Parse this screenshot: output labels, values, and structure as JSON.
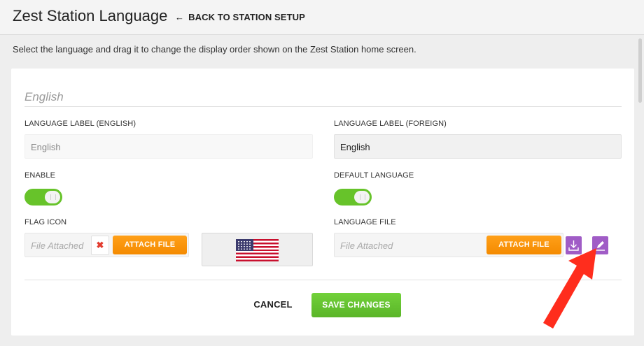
{
  "header": {
    "title": "Zest Station Language",
    "back_label": "BACK TO STATION SETUP"
  },
  "instructions": "Select the language and drag it to change the display order shown on the Zest Station home screen.",
  "language": {
    "name": "English",
    "label_english": {
      "label": "LANGUAGE LABEL (ENGLISH)",
      "value": "English"
    },
    "label_foreign": {
      "label": "LANGUAGE LABEL (FOREIGN)",
      "value": "English"
    },
    "enable": {
      "label": "ENABLE",
      "on": true
    },
    "default_language": {
      "label": "DEFAULT LANGUAGE",
      "on": true
    },
    "flag_icon": {
      "label": "FLAG ICON",
      "placeholder": "File Attached",
      "remove_glyph": "✖",
      "attach_label": "ATTACH FILE",
      "preview_icon": "us-flag"
    },
    "language_file": {
      "label": "LANGUAGE FILE",
      "placeholder": "File Attached",
      "attach_label": "ATTACH FILE",
      "download_icon": "download-icon",
      "edit_icon": "pencil-icon"
    }
  },
  "actions": {
    "cancel_label": "CANCEL",
    "save_label": "SAVE CHANGES"
  },
  "colors": {
    "accent_green": "#67c32a",
    "attach_orange": "#f7941d",
    "icon_purple": "#a05cc6",
    "annotation_red": "#ff2d1d"
  }
}
